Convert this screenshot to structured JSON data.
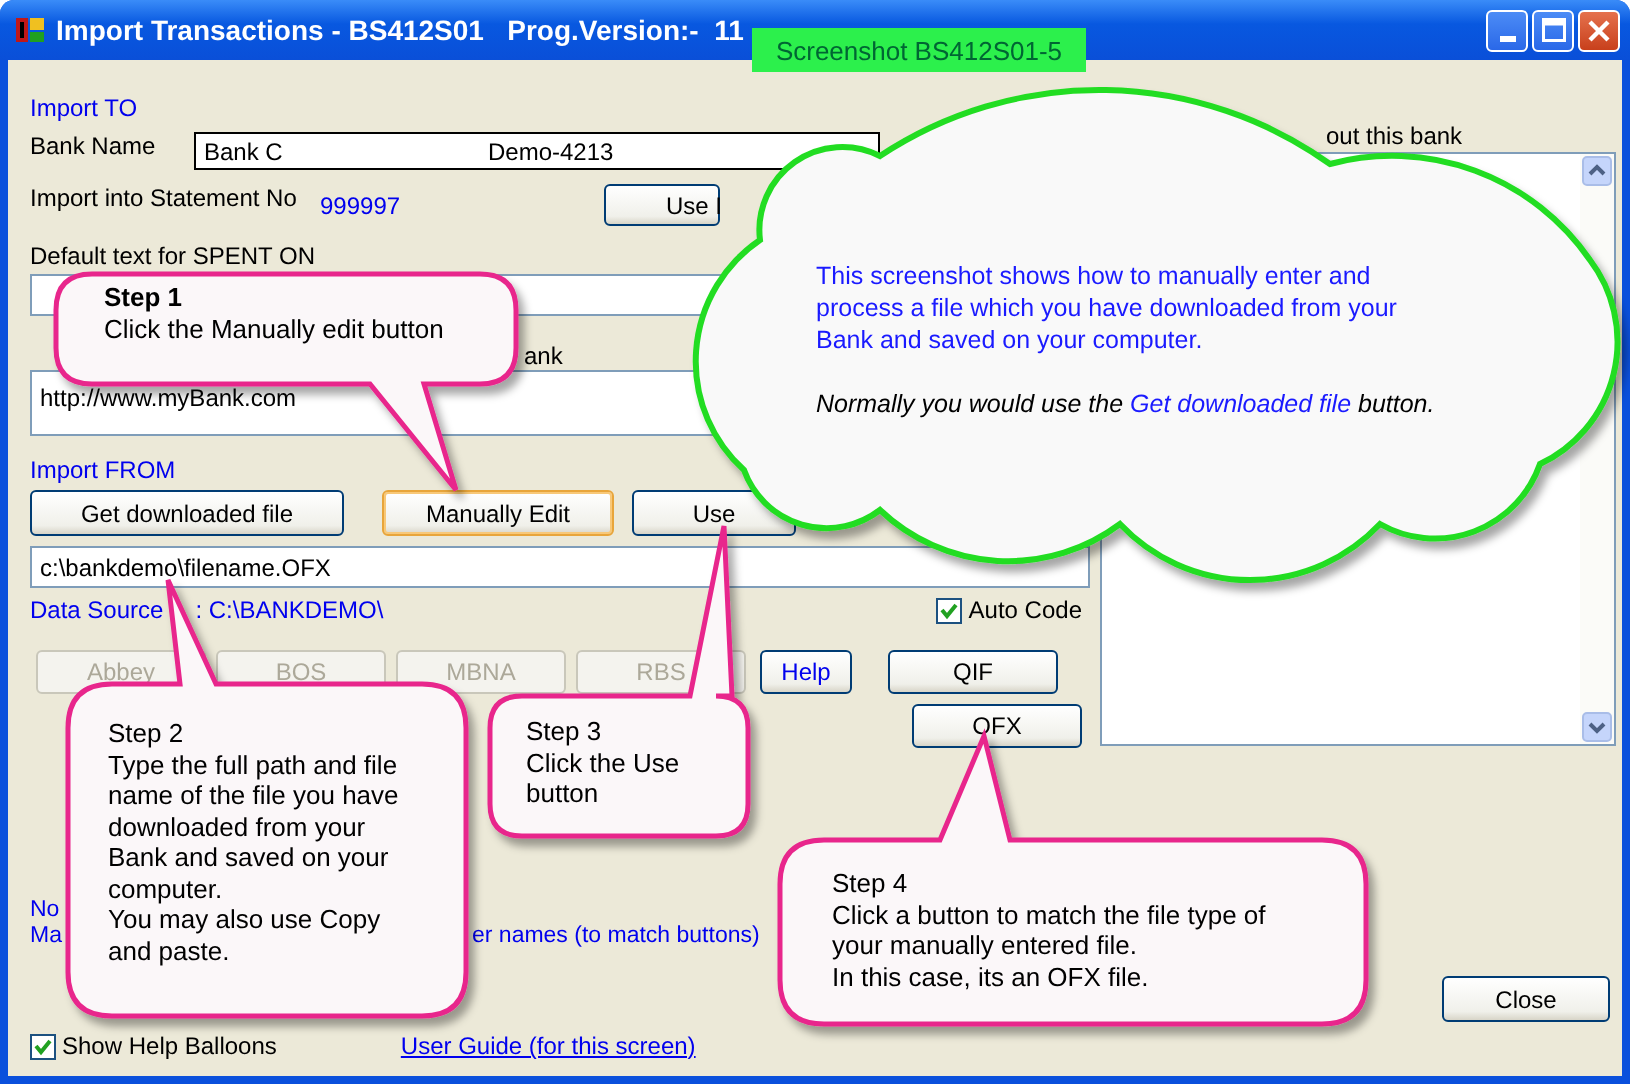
{
  "window": {
    "title": "Import Transactions - BS412S01   Prog.Version:-  11"
  },
  "screenshot_label": "Screenshot BS412S01-5",
  "import_to": {
    "heading": "Import TO",
    "bank_name_label": "Bank Name",
    "bank_name": "Bank C",
    "account": "Demo-4213",
    "statement_label": "Import into Statement No",
    "statement_no": "999997",
    "use_button": "Use I",
    "spent_on_label": "Default text for SPENT ON",
    "web_label": "ank",
    "web_address": "http://www.myBank.com"
  },
  "import_from": {
    "heading": "Import FROM",
    "buttons": [
      {
        "label": "Get downloaded file",
        "focused": false
      },
      {
        "label": "Manually Edit",
        "focused": true
      },
      {
        "label": "Use",
        "focused": false
      }
    ],
    "file_path": "c:\\bankdemo\\filename.OFX",
    "data_source_label": "Data Source",
    "data_source": ": C:\\BANKDEMO\\",
    "auto_code": {
      "label": "Auto Code",
      "checked": true
    }
  },
  "bank_buttons": [
    [
      {
        "label": "Abbey",
        "disabled": true
      },
      {
        "label": "BOS",
        "disabled": true
      },
      {
        "label": "MBNA",
        "disabled": true
      },
      {
        "label": "RBS",
        "disabled": true
      }
    ]
  ],
  "help_button": "Help",
  "format_buttons": [
    "QIF",
    "OFX"
  ],
  "notes_label": "out this bank",
  "note_lines": [
    {
      "start": "No"
    },
    {
      "start": "Ma",
      "end": "er names (to match buttons)"
    }
  ],
  "show_help_balloons": {
    "label": "Show Help Balloons",
    "checked": true
  },
  "user_guide_link": "User Guide (for this screen)",
  "close_button": "Close",
  "balloons": [
    {
      "title": "Step 1",
      "title_bold": true,
      "lines": [
        "Click the Manually edit button"
      ]
    },
    {
      "title": "Step 2",
      "title_bold": false,
      "lines": [
        "Type the full path and file",
        "name of the file you have",
        "downloaded from your",
        "Bank and saved on your",
        "computer.",
        "You may also use Copy",
        "and paste."
      ]
    },
    {
      "title": "Step 3",
      "title_bold": false,
      "lines": [
        "Click the Use",
        "button"
      ]
    },
    {
      "title": "Step 4",
      "title_bold": false,
      "lines": [
        "Click a button to match the file type of",
        "your manually entered file.",
        "In this case, its an OFX file."
      ]
    }
  ],
  "cloud": {
    "lines": [
      "This screenshot shows how to manually enter and",
      "process a file which you have downloaded from your",
      "Bank and saved on your computer."
    ],
    "note": [
      {
        "text": "Normally you would use the ",
        "highlight": false
      },
      {
        "text": "Get downloaded file",
        "highlight": true
      },
      {
        "text": " button.",
        "highlight": false
      }
    ]
  }
}
